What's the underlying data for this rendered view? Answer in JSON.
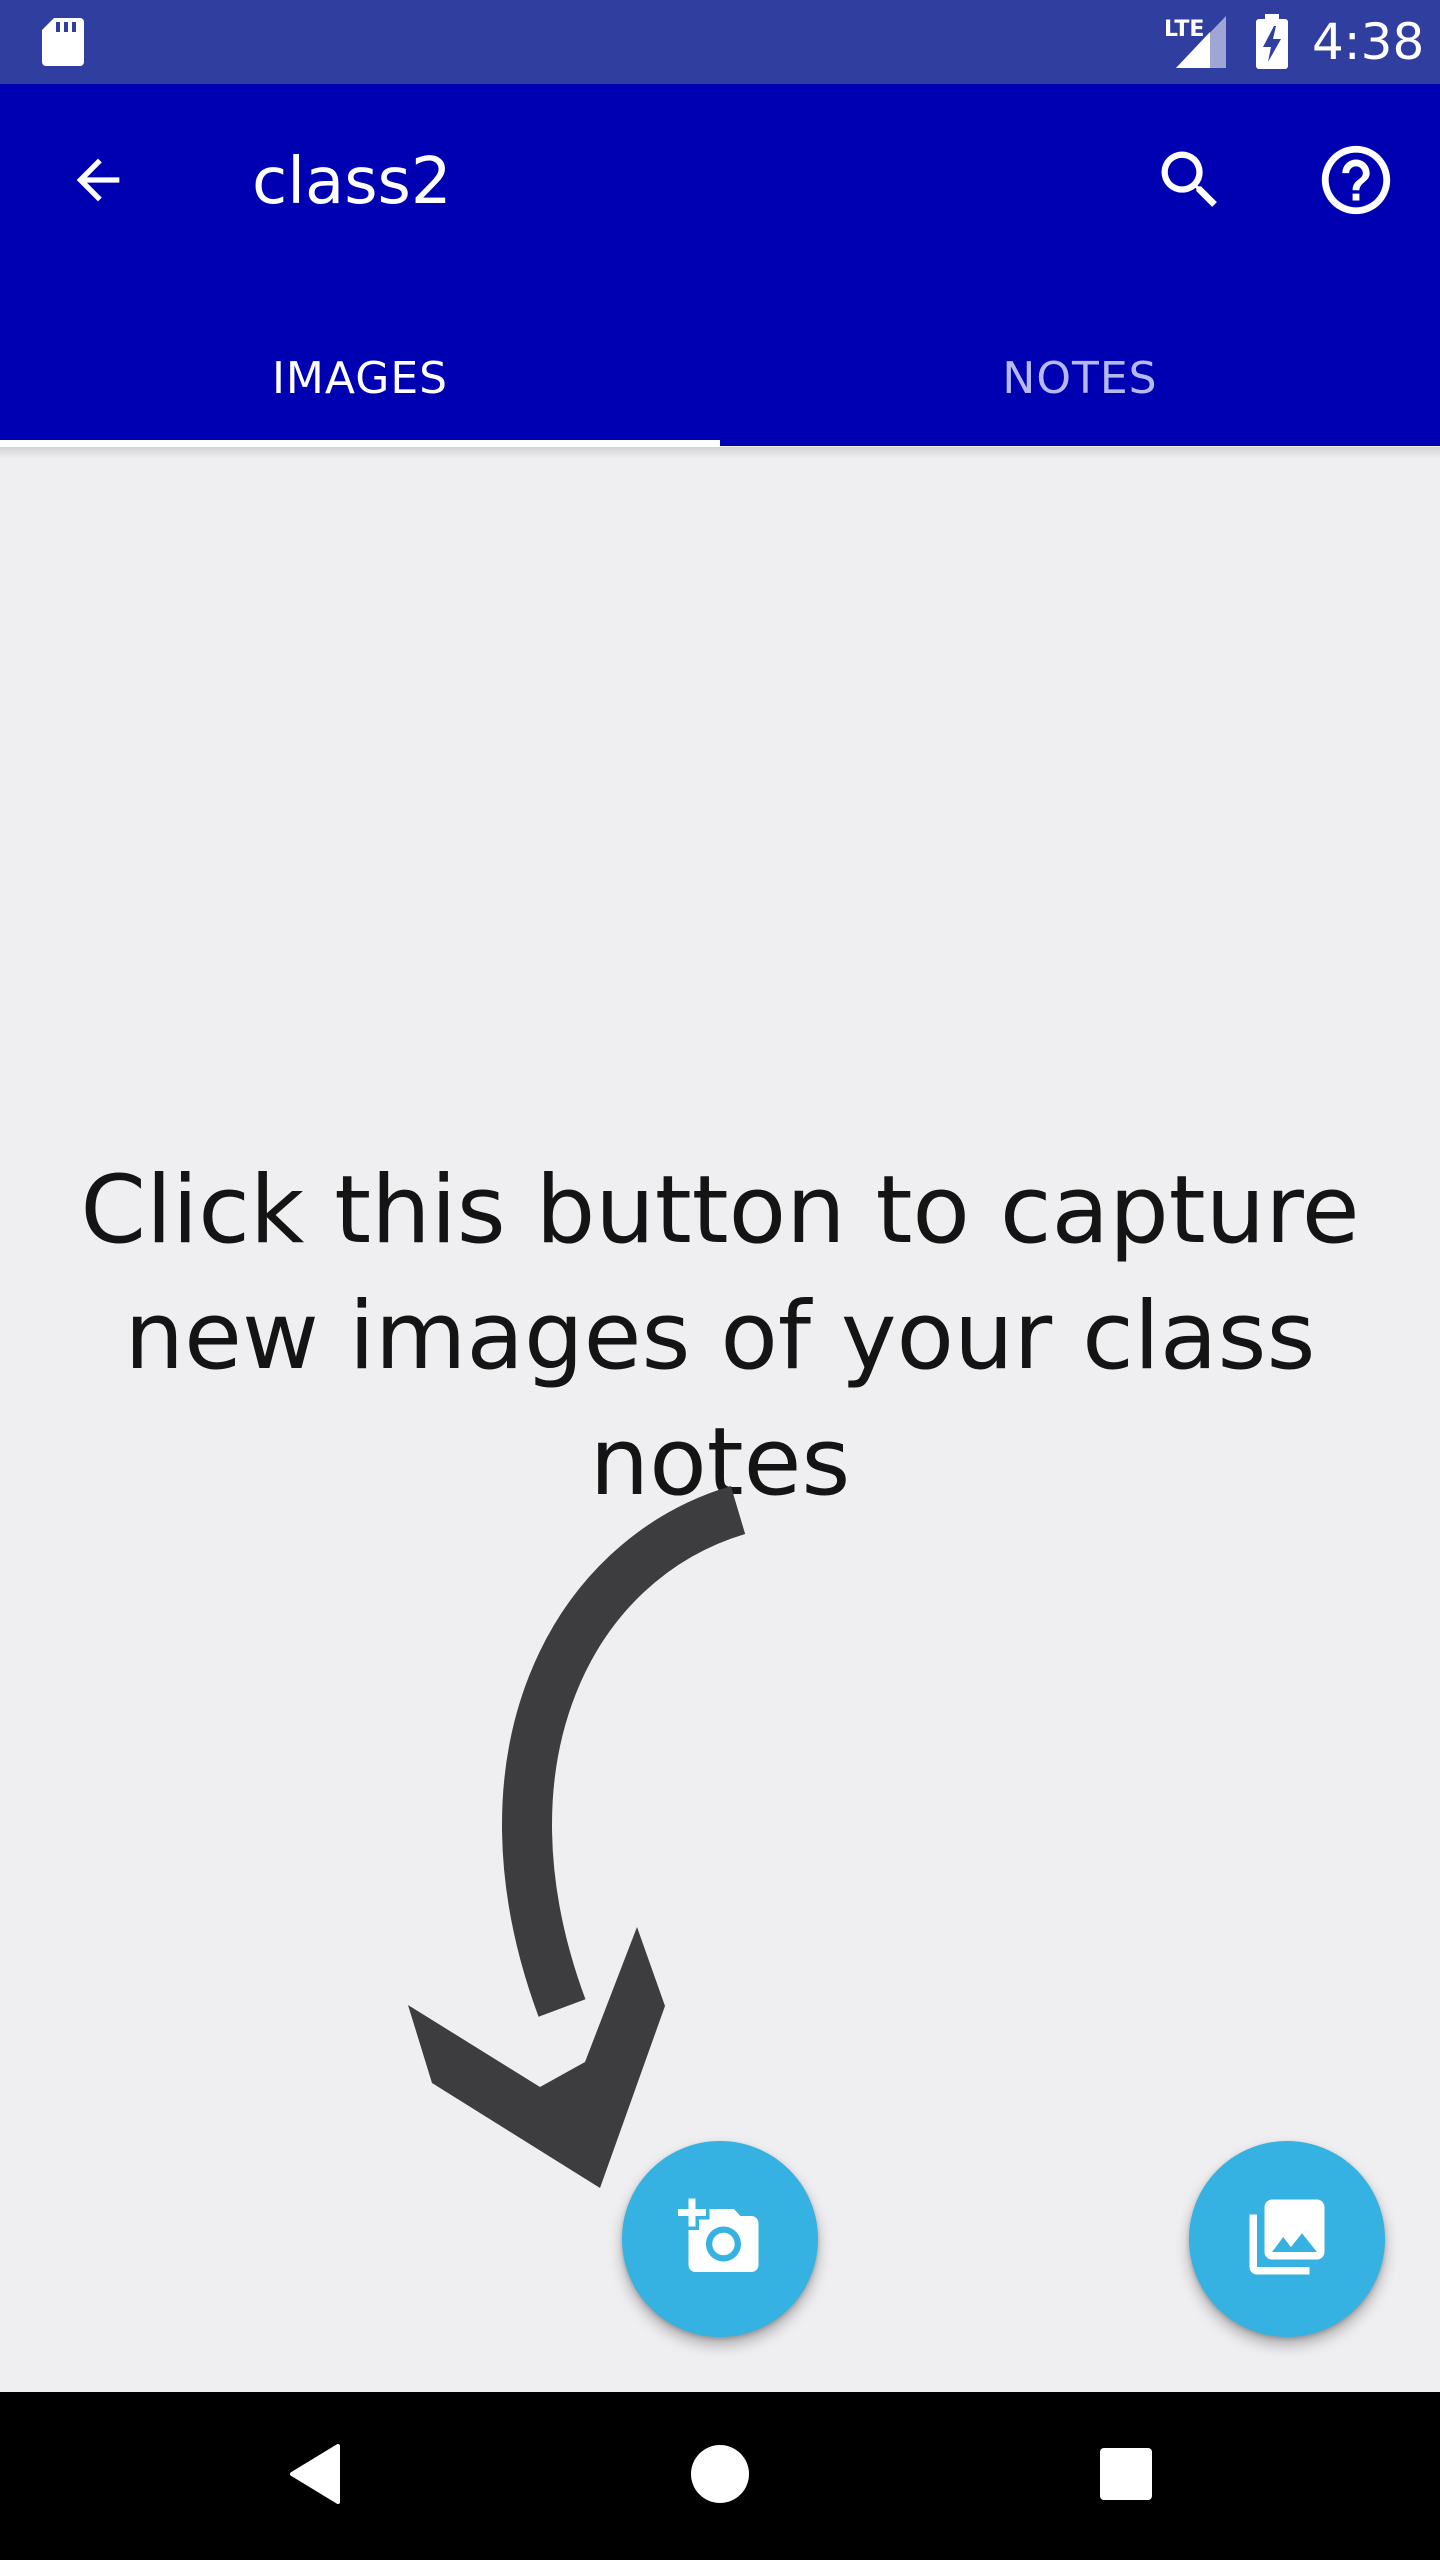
{
  "status_bar": {
    "time": "4:38",
    "network": "LTE",
    "icons": [
      "sd-card-icon",
      "lte-signal-icon",
      "battery-charging-icon"
    ]
  },
  "app_bar": {
    "title": "class2",
    "back_icon": "arrow-back-icon",
    "search_icon": "search-icon",
    "help_icon": "help-circle-icon"
  },
  "tabs": [
    {
      "label": "IMAGES",
      "selected": true
    },
    {
      "label": "NOTES",
      "selected": false
    }
  ],
  "main": {
    "hint": "Click this button to capture new images of your class notes",
    "arrow_icon": "curved-arrow-icon"
  },
  "fabs": {
    "capture_icon": "add-a-photo-icon",
    "gallery_icon": "photo-library-icon"
  },
  "nav_bar": {
    "icons": [
      "nav-back-icon",
      "nav-home-icon",
      "nav-recents-icon"
    ]
  },
  "colors": {
    "status_bar": "#303f9f",
    "app_bar": "#0000b3",
    "background": "#efeef1",
    "fab": "#35b2e2",
    "arrow": "#3d3c3f",
    "inactive_tab": "#b6b8f2"
  }
}
